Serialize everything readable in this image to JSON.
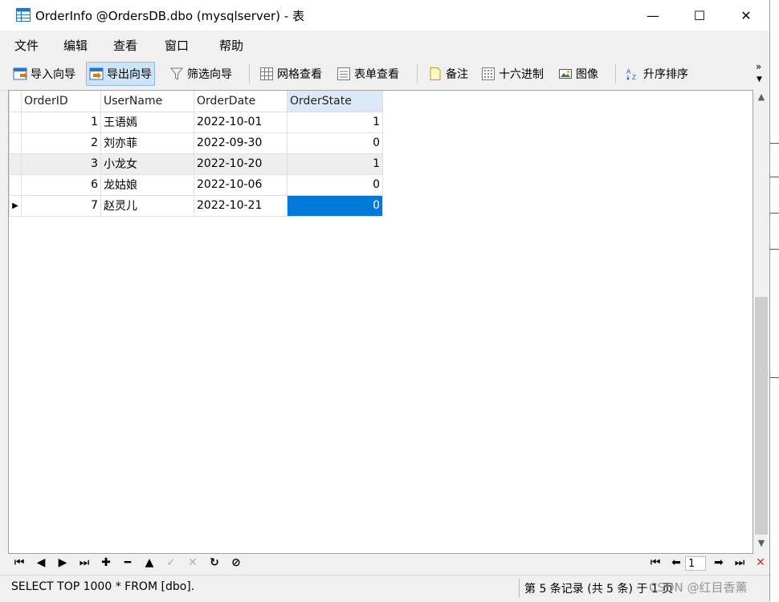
{
  "window": {
    "title": "OrderInfo @OrdersDB.dbo (mysqlserver) - 表",
    "minimize": "—",
    "maximize": "☐",
    "close": "✕"
  },
  "menu": [
    "文件",
    "编辑",
    "查看",
    "窗口",
    "帮助"
  ],
  "toolbar": {
    "import_wizard": "导入向导",
    "export_wizard": "导出向导",
    "filter_wizard": "筛选向导",
    "grid_view": "网格查看",
    "form_view": "表单查看",
    "memo": "备注",
    "hex": "十六进制",
    "image": "图像",
    "sort_asc": "升序排序",
    "more": "»"
  },
  "grid": {
    "columns": [
      "OrderID",
      "UserName",
      "OrderDate",
      "OrderState"
    ],
    "rows": [
      {
        "OrderID": "1",
        "UserName": "王语嫣",
        "OrderDate": "2022-10-01",
        "OrderState": "1"
      },
      {
        "OrderID": "2",
        "UserName": "刘亦菲",
        "OrderDate": "2022-09-30",
        "OrderState": "0"
      },
      {
        "OrderID": "3",
        "UserName": "小龙女",
        "OrderDate": "2022-10-20",
        "OrderState": "1"
      },
      {
        "OrderID": "6",
        "UserName": "龙姑娘",
        "OrderDate": "2022-10-06",
        "OrderState": "0"
      },
      {
        "OrderID": "7",
        "UserName": "赵灵儿",
        "OrderDate": "2022-10-21",
        "OrderState": "0"
      }
    ],
    "current_row_marker": "▶"
  },
  "navigator": {
    "page": "1"
  },
  "status": {
    "sql": "SELECT TOP 1000  * FROM [dbo].",
    "record_info": "第 5 条记录 (共 5 条) 于 1 页"
  },
  "watermark": "CSDN @红目香薰",
  "colors": {
    "selection": "#0078d7",
    "header_selected": "#dbe9f8",
    "toolbar_active": "#cde3f7"
  }
}
